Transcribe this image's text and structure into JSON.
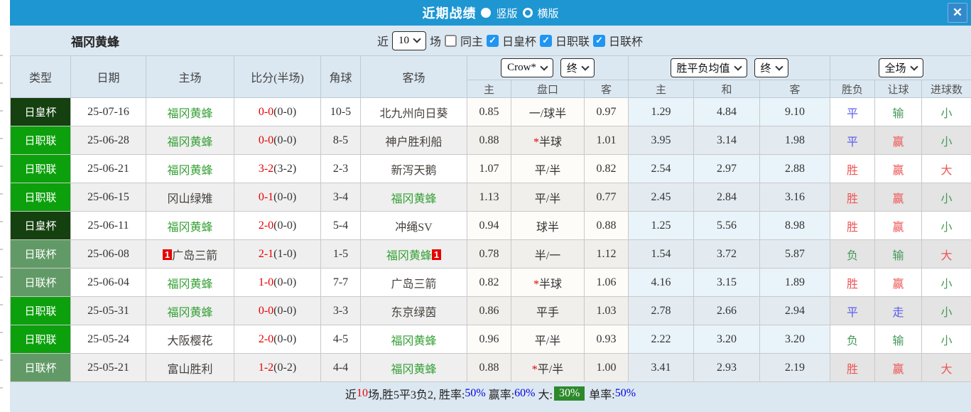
{
  "titlebar": {
    "title": "近期战绩",
    "vertical_label": "竖版",
    "horizontal_label": "横版",
    "close_glyph": "✕"
  },
  "filters": {
    "team": "福冈黄蜂",
    "near_label": "近",
    "count_value": "10",
    "matches_label": "场",
    "same_home_label": "同主",
    "league_royal": "日皇杯",
    "league_j": "日职联",
    "league_cup": "日联杯"
  },
  "selectors": {
    "bookmaker": "Crow*",
    "bookmaker_time": "终",
    "avg_type": "胜平负均值",
    "avg_time": "终",
    "scope": "全场"
  },
  "table": {
    "headers": {
      "type": "类型",
      "date": "日期",
      "home": "主场",
      "score": "比分(半场)",
      "corners": "角球",
      "away": "客场"
    },
    "sub_headers": {
      "h_home": "主",
      "h_line": "盘口",
      "h_away": "客",
      "a_home": "主",
      "a_draw": "和",
      "a_away": "客",
      "wdl": "胜负",
      "let": "让球",
      "goals": "进球数"
    },
    "rows": [
      {
        "type": "日皇杯",
        "type_class": "type-royal",
        "date": "25-07-16",
        "home_badge": "",
        "home": "福冈黄蜂",
        "home_class": "team-green",
        "score": "0-0",
        "half": "(0-0)",
        "corners": "10-5",
        "away": "北九州向日葵",
        "away_class": "team-plain",
        "away_badge": "",
        "odds_home": "0.85",
        "star": "",
        "handicap": "一/球半",
        "odds_away": "0.97",
        "avg_home": "1.29",
        "avg_draw": "4.84",
        "avg_away": "9.10",
        "wdl": "平",
        "wdl_class": "res-blue",
        "let_r": "输",
        "let_class": "res-green",
        "goals": "小",
        "goals_class": "res-green"
      },
      {
        "type": "日职联",
        "type_class": "type-league",
        "date": "25-06-28",
        "home_badge": "",
        "home": "福冈黄蜂",
        "home_class": "team-green",
        "score": "0-0",
        "half": "(0-0)",
        "corners": "8-5",
        "away": "神户胜利船",
        "away_class": "team-plain",
        "away_badge": "",
        "odds_home": "0.88",
        "star": "*",
        "handicap": "半球",
        "odds_away": "1.01",
        "avg_home": "3.95",
        "avg_draw": "3.14",
        "avg_away": "1.98",
        "wdl": "平",
        "wdl_class": "res-blue",
        "let_r": "赢",
        "let_class": "res-red",
        "goals": "小",
        "goals_class": "res-green"
      },
      {
        "type": "日职联",
        "type_class": "type-league",
        "date": "25-06-21",
        "home_badge": "",
        "home": "福冈黄蜂",
        "home_class": "team-green",
        "score": "3-2",
        "half": "(3-2)",
        "corners": "2-3",
        "away": "新泻天鹅",
        "away_class": "team-plain",
        "away_badge": "",
        "odds_home": "1.07",
        "star": "",
        "handicap": "平/半",
        "odds_away": "0.82",
        "avg_home": "2.54",
        "avg_draw": "2.97",
        "avg_away": "2.88",
        "wdl": "胜",
        "wdl_class": "res-red",
        "let_r": "赢",
        "let_class": "res-red",
        "goals": "大",
        "goals_class": "res-red"
      },
      {
        "type": "日职联",
        "type_class": "type-league",
        "date": "25-06-15",
        "home_badge": "",
        "home": "冈山绿雉",
        "home_class": "team-plain",
        "score": "0-1",
        "half": "(0-0)",
        "corners": "3-4",
        "away": "福冈黄蜂",
        "away_class": "team-green",
        "away_badge": "",
        "odds_home": "1.13",
        "star": "",
        "handicap": "平/半",
        "odds_away": "0.77",
        "avg_home": "2.45",
        "avg_draw": "2.84",
        "avg_away": "3.16",
        "wdl": "胜",
        "wdl_class": "res-red",
        "let_r": "赢",
        "let_class": "res-red",
        "goals": "小",
        "goals_class": "res-green"
      },
      {
        "type": "日皇杯",
        "type_class": "type-royal",
        "date": "25-06-11",
        "home_badge": "",
        "home": "福冈黄蜂",
        "home_class": "team-green",
        "score": "2-0",
        "half": "(0-0)",
        "corners": "5-4",
        "away": "冲绳SV",
        "away_class": "team-plain",
        "away_badge": "",
        "odds_home": "0.94",
        "star": "",
        "handicap": "球半",
        "odds_away": "0.88",
        "avg_home": "1.25",
        "avg_draw": "5.56",
        "avg_away": "8.98",
        "wdl": "胜",
        "wdl_class": "res-red",
        "let_r": "赢",
        "let_class": "res-red",
        "goals": "小",
        "goals_class": "res-green"
      },
      {
        "type": "日联杯",
        "type_class": "type-cup",
        "date": "25-06-08",
        "home_badge": "1",
        "home": "广岛三箭",
        "home_class": "team-plain",
        "score": "2-1",
        "half": "(1-0)",
        "corners": "1-5",
        "away": "福冈黄蜂",
        "away_class": "team-green",
        "away_badge": "1",
        "odds_home": "0.78",
        "star": "",
        "handicap": "半/一",
        "odds_away": "1.12",
        "avg_home": "1.54",
        "avg_draw": "3.72",
        "avg_away": "5.87",
        "wdl": "负",
        "wdl_class": "res-green",
        "let_r": "输",
        "let_class": "res-green",
        "goals": "大",
        "goals_class": "res-red"
      },
      {
        "type": "日联杯",
        "type_class": "type-cup",
        "date": "25-06-04",
        "home_badge": "",
        "home": "福冈黄蜂",
        "home_class": "team-green",
        "score": "1-0",
        "half": "(0-0)",
        "corners": "7-7",
        "away": "广岛三箭",
        "away_class": "team-plain",
        "away_badge": "",
        "odds_home": "0.82",
        "star": "*",
        "handicap": "半球",
        "odds_away": "1.06",
        "avg_home": "4.16",
        "avg_draw": "3.15",
        "avg_away": "1.89",
        "wdl": "胜",
        "wdl_class": "res-red",
        "let_r": "赢",
        "let_class": "res-red",
        "goals": "小",
        "goals_class": "res-green"
      },
      {
        "type": "日职联",
        "type_class": "type-league",
        "date": "25-05-31",
        "home_badge": "",
        "home": "福冈黄蜂",
        "home_class": "team-green",
        "score": "0-0",
        "half": "(0-0)",
        "corners": "3-3",
        "away": "东京绿茵",
        "away_class": "team-plain",
        "away_badge": "",
        "odds_home": "0.86",
        "star": "",
        "handicap": "平手",
        "odds_away": "1.03",
        "avg_home": "2.78",
        "avg_draw": "2.66",
        "avg_away": "2.94",
        "wdl": "平",
        "wdl_class": "res-blue",
        "let_r": "走",
        "let_class": "res-blue",
        "goals": "小",
        "goals_class": "res-green"
      },
      {
        "type": "日职联",
        "type_class": "type-league",
        "date": "25-05-24",
        "home_badge": "",
        "home": "大阪樱花",
        "home_class": "team-plain",
        "score": "2-0",
        "half": "(0-0)",
        "corners": "4-5",
        "away": "福冈黄蜂",
        "away_class": "team-green",
        "away_badge": "",
        "odds_home": "0.96",
        "star": "",
        "handicap": "平/半",
        "odds_away": "0.93",
        "avg_home": "2.22",
        "avg_draw": "3.20",
        "avg_away": "3.20",
        "wdl": "负",
        "wdl_class": "res-green",
        "let_r": "输",
        "let_class": "res-green",
        "goals": "小",
        "goals_class": "res-green"
      },
      {
        "type": "日联杯",
        "type_class": "type-cup",
        "date": "25-05-21",
        "home_badge": "",
        "home": "富山胜利",
        "home_class": "team-plain",
        "score": "1-2",
        "half": "(0-2)",
        "corners": "4-4",
        "away": "福冈黄蜂",
        "away_class": "team-green",
        "away_badge": "",
        "odds_home": "0.88",
        "star": "*",
        "handicap": "平/半",
        "odds_away": "1.00",
        "avg_home": "3.41",
        "avg_draw": "2.93",
        "avg_away": "2.19",
        "wdl": "胜",
        "wdl_class": "res-red",
        "let_r": "赢",
        "let_class": "res-red",
        "goals": "大",
        "goals_class": "res-red"
      }
    ]
  },
  "footer": {
    "prefix": "近",
    "count": "10",
    "record": "场,胜5平3负2, 胜率:",
    "win_rate": "50%",
    "sep1": " 赢率:",
    "handicap_rate": "60%",
    "sep2": " 大:",
    "big_rate": "30%",
    "sep3": " 单率:",
    "odd_rate": "50%"
  }
}
